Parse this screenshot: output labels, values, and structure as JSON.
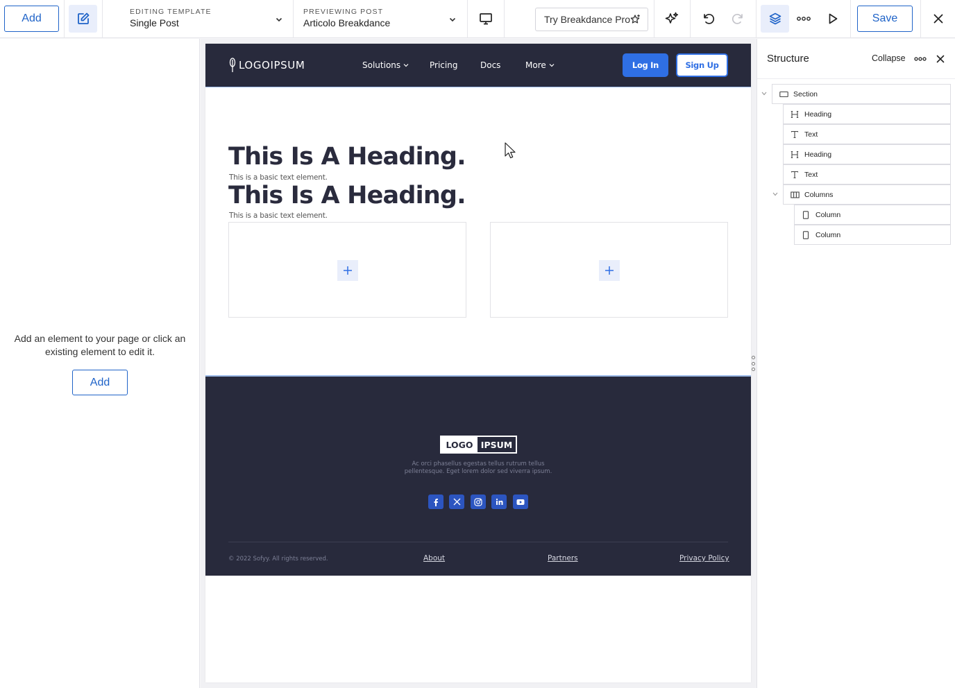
{
  "toolbar": {
    "add_label": "Add",
    "editing_caption": "EDITING TEMPLATE",
    "editing_value": "Single Post",
    "previewing_caption": "PREVIEWING POST",
    "previewing_value": "Articolo Breakdance",
    "try_pro_label": "Try Breakdance Pro",
    "save_label": "Save"
  },
  "left_panel": {
    "message": "Add an element to your page or click an existing element to edit it.",
    "add_label": "Add"
  },
  "site": {
    "logo_text": "LOGOIPSUM",
    "nav": [
      {
        "label": "Solutions",
        "has_caret": true
      },
      {
        "label": "Pricing",
        "has_caret": false
      },
      {
        "label": "Docs",
        "has_caret": false
      },
      {
        "label": "More",
        "has_caret": true
      }
    ],
    "login_label": "Log In",
    "signup_label": "Sign Up",
    "heading_1": "This Is A Heading.",
    "text_1": "This is a basic text element.",
    "heading_2": "This Is A Heading.",
    "text_2": "This is a basic text element.",
    "footer": {
      "logo_part_1": "LOGO",
      "logo_part_2": "IPSUM",
      "description": "Ac orci phasellus egestas tellus rutrum tellus pellentesque. Eget lorem dolor sed viverra ipsum.",
      "socials": [
        "facebook-icon",
        "x-icon",
        "instagram-icon",
        "linkedin-icon",
        "youtube-icon"
      ],
      "copyright": "© 2022 Sofyy. All rights reserved.",
      "links": [
        "About",
        "Partners",
        "Privacy Policy"
      ]
    }
  },
  "structure": {
    "title": "Structure",
    "collapse_label": "Collapse",
    "items": [
      {
        "label": "Section",
        "icon": "section-icon"
      },
      {
        "label": "Heading",
        "icon": "heading-icon"
      },
      {
        "label": "Text",
        "icon": "text-icon"
      },
      {
        "label": "Heading",
        "icon": "heading-icon"
      },
      {
        "label": "Text",
        "icon": "text-icon"
      },
      {
        "label": "Columns",
        "icon": "columns-icon"
      },
      {
        "label": "Column",
        "icon": "column-icon"
      },
      {
        "label": "Column",
        "icon": "column-icon"
      }
    ]
  },
  "colors": {
    "accent": "#1f63c8",
    "site_dark": "#282a3c",
    "site_blue": "#2f6fe4"
  }
}
